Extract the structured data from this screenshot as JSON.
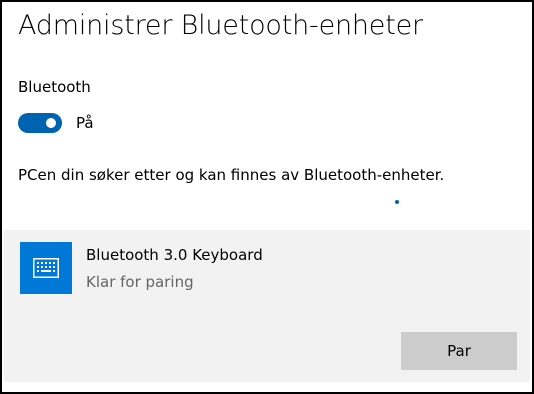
{
  "page": {
    "title": "Administrer Bluetooth-enheter"
  },
  "bluetooth": {
    "label": "Bluetooth",
    "toggle_state_label": "På",
    "toggle_on": true
  },
  "status_text": "PCen din søker etter og kan finnes av Bluetooth-enheter.",
  "device": {
    "name": "Bluetooth 3.0 Keyboard",
    "status": "Klar for paring",
    "icon": "keyboard-icon",
    "pair_label": "Par"
  },
  "colors": {
    "accent": "#0063b1",
    "device_tile": "#0078d7",
    "panel_bg": "#f2f2f2",
    "button_bg": "#cccccc"
  }
}
